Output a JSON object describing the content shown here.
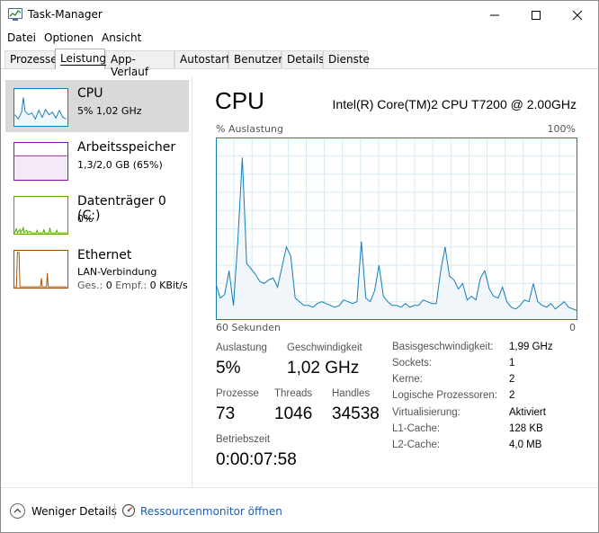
{
  "window": {
    "title": "Task-Manager"
  },
  "menu": [
    "Datei",
    "Optionen",
    "Ansicht"
  ],
  "tabs": [
    "Prozesse",
    "Leistung",
    "App-Verlauf",
    "Autostart",
    "Benutzer",
    "Details",
    "Dienste"
  ],
  "active_tab": "Leistung",
  "sidebar": {
    "items": [
      {
        "name": "CPU",
        "line1": "5% 1,02 GHz",
        "color": "#117dbb",
        "selected": true
      },
      {
        "name": "Arbeitsspeicher",
        "line1": "1,3/2,0 GB (65%)",
        "color": "#8b12ae",
        "selected": false
      },
      {
        "name": "Datenträger 0 (C:)",
        "line1": "0%",
        "color": "#4da60c",
        "selected": false
      },
      {
        "name": "Ethernet",
        "line1": "LAN-Verbindung",
        "line2_label_send": "Ges.:",
        "line2_send_value": "0",
        "line2_label_recv": "Empf.:",
        "line2_recv_value": "0 KBit/s",
        "color": "#a74f01",
        "selected": false
      }
    ]
  },
  "main": {
    "title": "CPU",
    "model": "Intel(R) Core(TM)2 CPU T7200 @ 2.00GHz",
    "axis": {
      "top_left": "% Auslastung",
      "top_right": "100%",
      "bottom_left": "60 Sekunden",
      "bottom_right": "0"
    },
    "stats": {
      "auslastung_label": "Auslastung",
      "auslastung_value": "5%",
      "geschwindigkeit_label": "Geschwindigkeit",
      "geschwindigkeit_value": "1,02 GHz",
      "prozesse_label": "Prozesse",
      "prozesse_value": "73",
      "threads_label": "Threads",
      "threads_value": "1046",
      "handles_label": "Handles",
      "handles_value": "34538",
      "betriebszeit_label": "Betriebszeit",
      "betriebszeit_value": "0:00:07:58"
    },
    "info": [
      {
        "label": "Basisgeschwindigkeit:",
        "value": "1,99 GHz"
      },
      {
        "label": "Sockets:",
        "value": "1"
      },
      {
        "label": "Kerne:",
        "value": "2"
      },
      {
        "label": "Logische Prozessoren:",
        "value": "2"
      },
      {
        "label": "Virtualisierung:",
        "value": "Aktiviert"
      },
      {
        "label": "L1-Cache:",
        "value": "128 KB"
      },
      {
        "label": "L2-Cache:",
        "value": "4,0 MB"
      }
    ]
  },
  "footer": {
    "fewer_details": "Weniger Details",
    "resource_monitor": "Ressourcenmonitor öffnen"
  },
  "chart_data": {
    "type": "area",
    "x_range": [
      60,
      0
    ],
    "ylim": [
      0,
      100
    ],
    "grid": true,
    "series": [
      {
        "values": [
          20,
          12,
          14,
          27,
          8,
          44,
          89,
          31,
          28,
          25,
          21,
          20,
          22,
          23,
          18,
          29,
          40,
          35,
          12,
          10,
          8,
          8,
          7,
          9,
          10,
          9,
          8,
          7,
          8,
          11,
          10,
          9,
          10,
          43,
          12,
          10,
          16,
          30,
          13,
          10,
          8,
          8,
          7,
          9,
          7,
          8,
          8,
          11,
          10,
          9,
          9,
          27,
          40,
          24,
          22,
          17,
          20,
          11,
          13,
          11,
          23,
          27,
          17,
          13,
          12,
          18,
          10,
          7,
          6,
          8,
          11,
          10,
          20,
          10,
          8,
          7,
          9,
          6,
          8,
          10,
          7,
          6,
          5
        ]
      }
    ]
  }
}
